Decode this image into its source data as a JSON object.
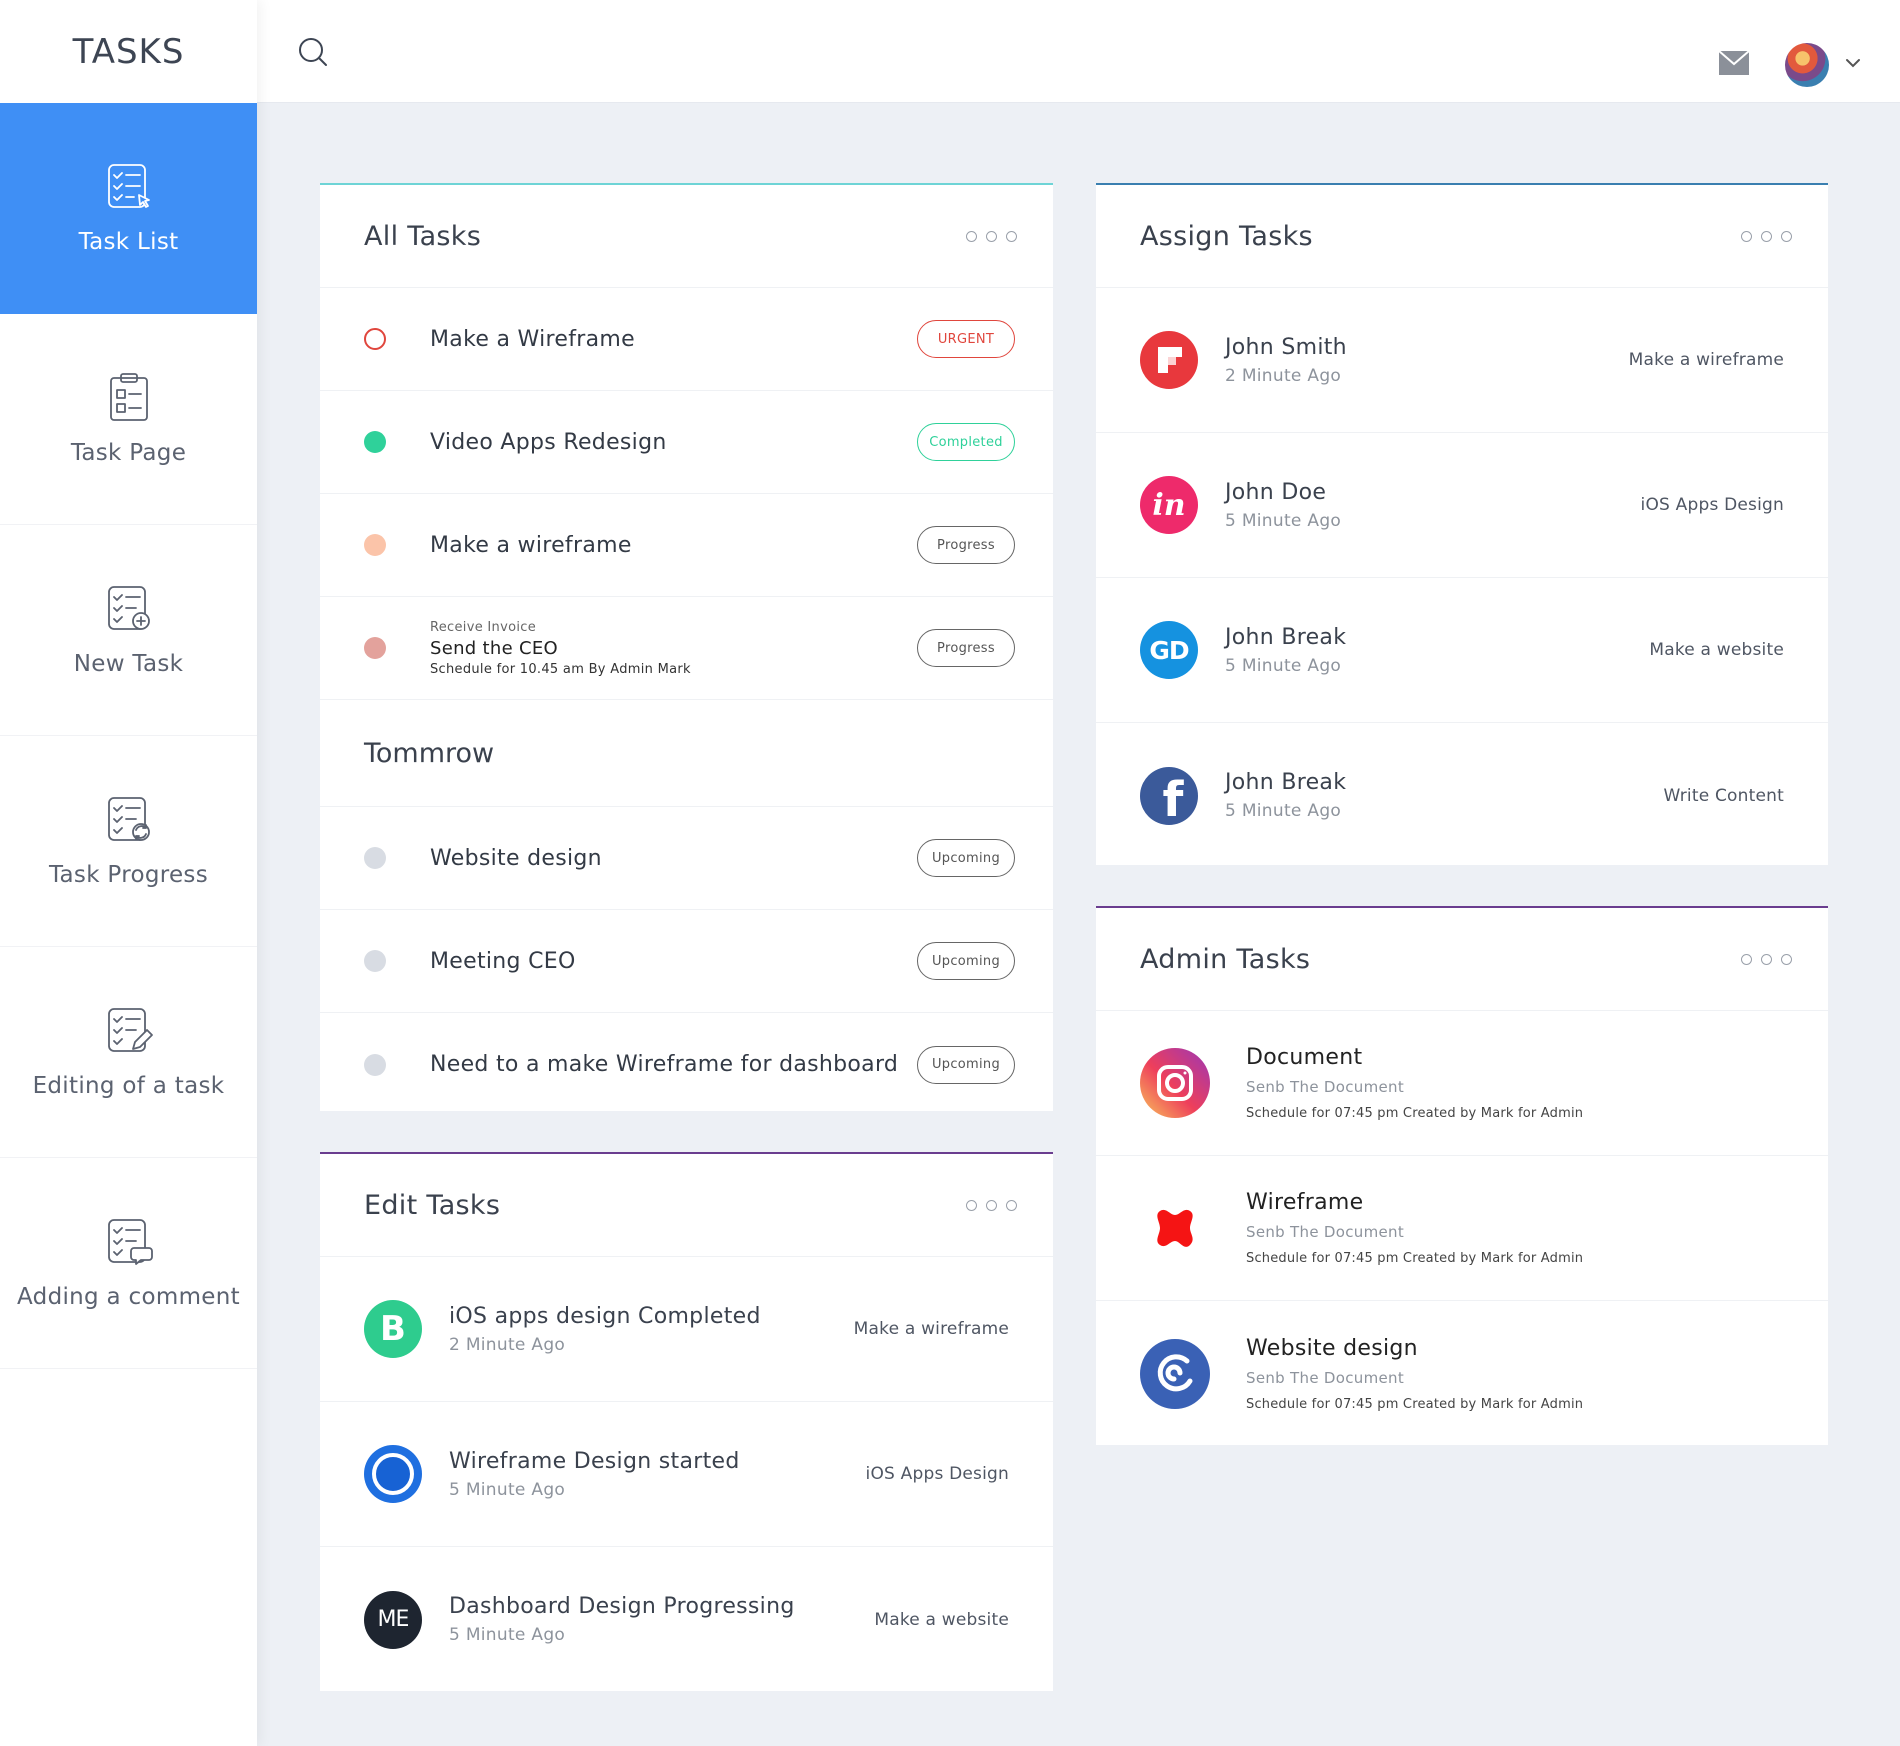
{
  "brand": "TASKS",
  "nav": [
    {
      "label": "Task List"
    },
    {
      "label": "Task Page"
    },
    {
      "label": "New Task"
    },
    {
      "label": "Task Progress"
    },
    {
      "label": "Editing of a task"
    },
    {
      "label": "Adding a comment"
    }
  ],
  "colors": {
    "accent": "#3f8ff5",
    "urgent": "#e0463d",
    "completed": "#2fd19a",
    "progress": "#fbc4a9",
    "progress2": "#e3a29c",
    "upcoming": "#d8dce3"
  },
  "all_tasks": {
    "title": "All Tasks",
    "items": [
      {
        "text": "Make a Wireframe",
        "badge": "URGENT"
      },
      {
        "text": "Video Apps Redesign",
        "badge": "Completed"
      },
      {
        "text": "Make a wireframe",
        "badge": "Progress"
      },
      {
        "pre": "Receive Invoice",
        "text": "Send the CEO",
        "sub": "Schedule for 10.45 am By Admin Mark",
        "badge": "Progress"
      }
    ],
    "tomorrow_title": "Tommrow",
    "tomorrow": [
      {
        "text": "Website design",
        "badge": "Upcoming"
      },
      {
        "text": "Meeting CEO",
        "badge": "Upcoming"
      },
      {
        "text": "Need to a make Wireframe for dashboard",
        "badge": "Upcoming"
      }
    ]
  },
  "edit_tasks": {
    "title": "Edit Tasks",
    "items": [
      {
        "icon": "b-logo-icon",
        "title": "iOS apps design Completed",
        "time": "2 Minute Ago",
        "right": "Make a wireframe"
      },
      {
        "icon": "ring-logo-icon",
        "title": "Wireframe Design started",
        "time": "5 Minute Ago",
        "right": "iOS Apps Design"
      },
      {
        "icon": "me-logo-icon",
        "logo_text": "ME",
        "title": "Dashboard Design Progressing",
        "time": "5 Minute Ago",
        "right": "Make a website"
      }
    ]
  },
  "assign_tasks": {
    "title": "Assign Tasks",
    "items": [
      {
        "icon": "flipboard-logo-icon",
        "name": "John Smith",
        "time": "2 Minute Ago",
        "right": "Make a wireframe"
      },
      {
        "icon": "invision-logo-icon",
        "logo_text": "in",
        "name": "John Doe",
        "time": "5 Minute Ago",
        "right": "iOS Apps Design"
      },
      {
        "icon": "gd-logo-icon",
        "logo_text": "GD",
        "name": "John Break",
        "time": "5 Minute Ago",
        "right": "Make a website"
      },
      {
        "icon": "facebook-logo-icon",
        "logo_text": "f",
        "name": "John Break",
        "time": "5 Minute Ago",
        "right": "Write Content"
      }
    ]
  },
  "admin_tasks": {
    "title": "Admin Tasks",
    "items": [
      {
        "icon": "instagram-logo-icon",
        "name": "Document",
        "sub": "Senb The Document",
        "schedule": "Schedule for 07:45 pm Created by Mark for Admin"
      },
      {
        "icon": "red-x-logo-icon",
        "name": "Wireframe",
        "sub": "Senb The Document",
        "schedule": "Schedule for 07:45 pm Created by Mark for Admin"
      },
      {
        "icon": "swirl-logo-icon",
        "name": "Website design",
        "sub": "Senb The Document",
        "schedule": "Schedule for 07:45 pm Created by Mark for Admin"
      }
    ]
  }
}
